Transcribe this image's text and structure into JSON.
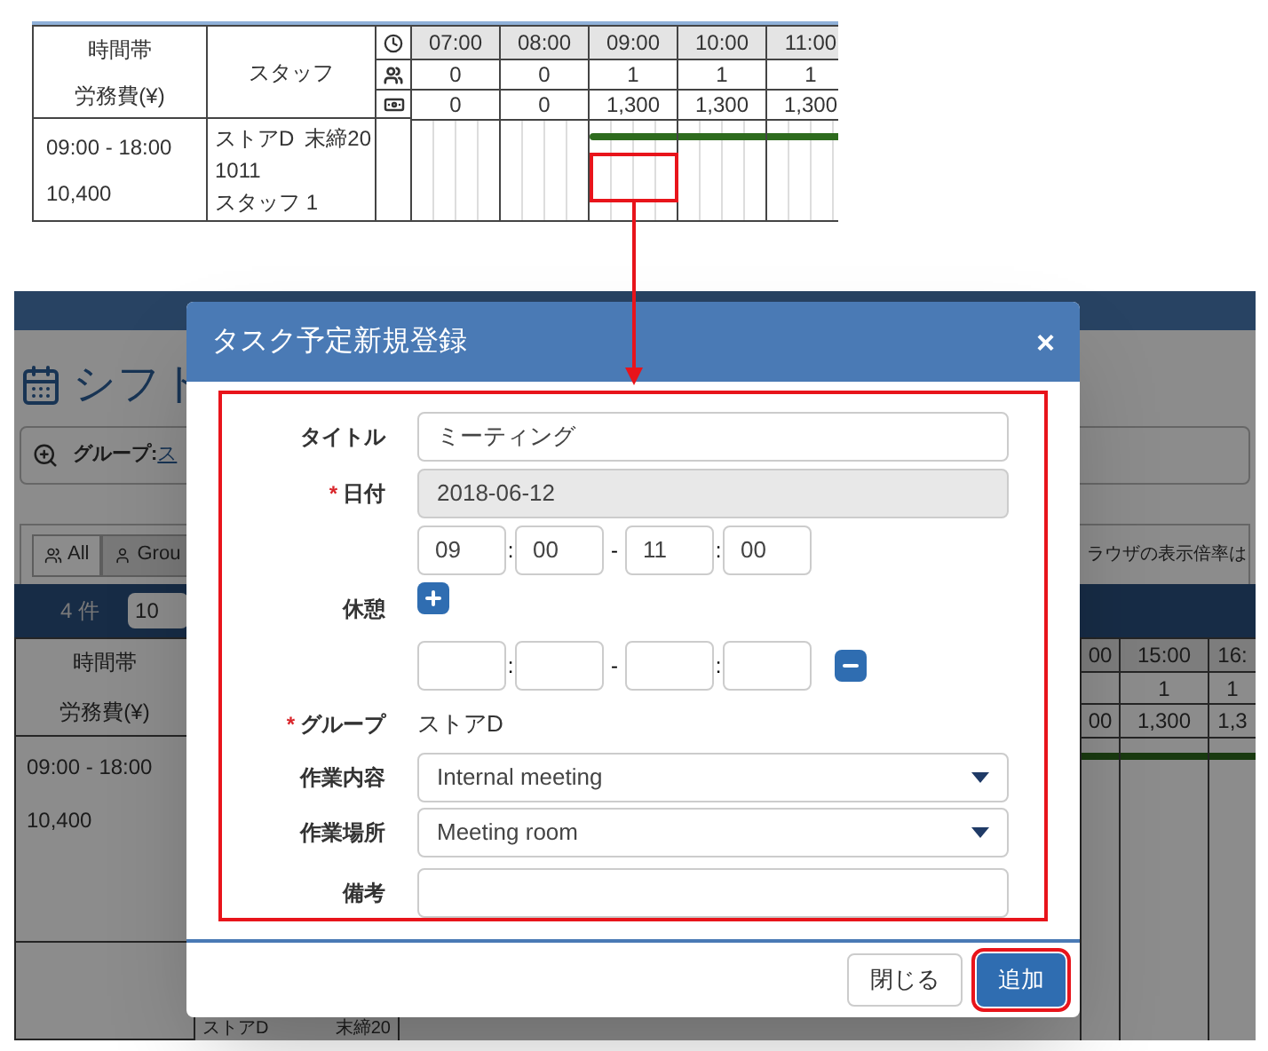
{
  "snippet_table": {
    "time_header": [
      "時間帯",
      "労務費(¥)"
    ],
    "staff_header": "スタッフ",
    "hours": [
      "07:00",
      "08:00",
      "09:00",
      "10:00",
      "11:00"
    ],
    "staff_counts": [
      "0",
      "0",
      "1",
      "1",
      "1"
    ],
    "costs": [
      "0",
      "0",
      "1,300",
      "1,300",
      "1,300"
    ],
    "row": {
      "time": "09:00 - 18:00",
      "cost": "10,400",
      "group": "ストアD",
      "closing": "末締20",
      "code": "1011",
      "staff": "スタッフ 1"
    }
  },
  "background_page": {
    "title": "シフト",
    "search_label": "グループ:",
    "search_link": "ス",
    "view_buttons": [
      {
        "label": "All",
        "selected": false
      },
      {
        "label": "Grou",
        "selected": true
      }
    ],
    "notice": "ラウザの表示倍率は",
    "count": "4 件",
    "page_size": "10",
    "table": {
      "time_header": [
        "時間帯",
        "労務費(¥)"
      ],
      "hours": [
        "00",
        "15:00",
        "16:"
      ],
      "staff_counts": [
        "1",
        "1"
      ],
      "costs": [
        "00",
        "1,300",
        "1,3"
      ],
      "rows": [
        {
          "time": "09:00 - 18:00",
          "cost": "10,400"
        }
      ],
      "last_row": {
        "group": "ストアD",
        "closing": "末締20"
      }
    }
  },
  "dialog": {
    "title": "タスク予定新規登録",
    "close": "×",
    "required_mark": "*",
    "title_field": {
      "label": "タイトル",
      "value": "ミーティング",
      "required": false
    },
    "date_field": {
      "label": "日付",
      "value": "2018-06-12",
      "required": true,
      "disabled": true
    },
    "work_time": {
      "start_hour": "09",
      "start_minute": "00",
      "end_hour": "11",
      "end_minute": "00"
    },
    "separators": [
      ":",
      "-",
      ":"
    ],
    "break": {
      "label": "休憩",
      "entries": [
        {
          "kind": "empty"
        }
      ]
    },
    "group": {
      "label": "グループ",
      "value": "ストアD",
      "required": true
    },
    "task_type": {
      "label": "作業内容",
      "value": "Internal meeting"
    },
    "location": {
      "label": "作業場所",
      "value": "Meeting room"
    },
    "note": {
      "label": "備考"
    },
    "buttons": [
      {
        "label": "閉じる",
        "kind": "secondary"
      },
      {
        "label": "追加",
        "kind": "primary"
      }
    ]
  }
}
